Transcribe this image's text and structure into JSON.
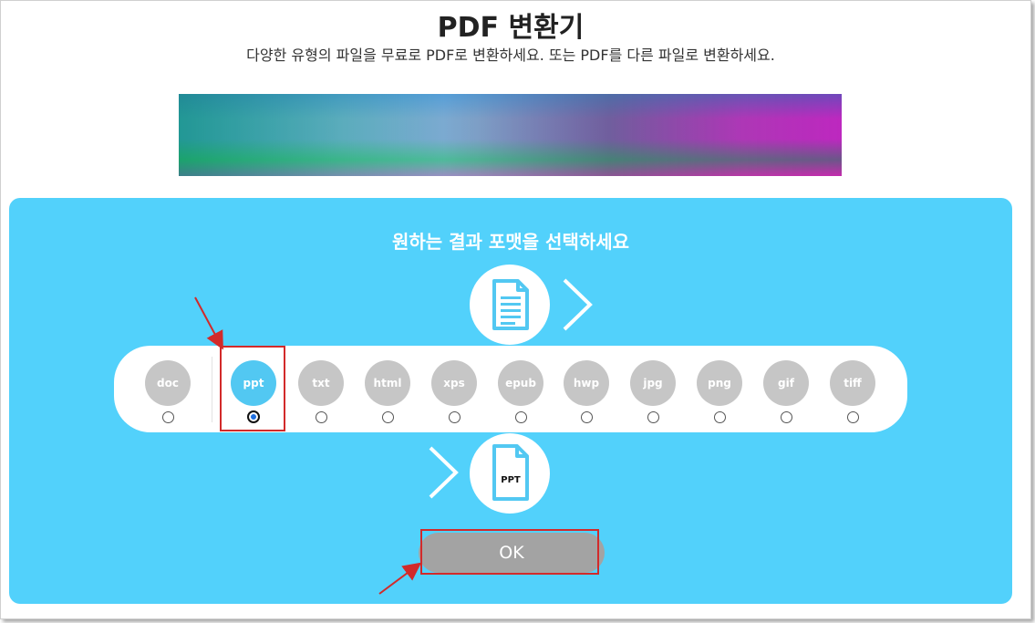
{
  "header": {
    "title": "PDF 변환기",
    "subtitle": "다양한 유형의 파일을 무료로 PDF로 변환하세요. 또는 PDF를 다른 파일로 변환하세요."
  },
  "converter": {
    "heading": "원하는 결과 포맷을 선택하세요",
    "source_icon": "document-icon",
    "target_icon": "ppt-file-icon",
    "target_label": "PPT",
    "formats": [
      {
        "label": "doc",
        "selected": false
      },
      {
        "label": "ppt",
        "selected": true
      },
      {
        "label": "txt",
        "selected": false
      },
      {
        "label": "html",
        "selected": false
      },
      {
        "label": "xps",
        "selected": false
      },
      {
        "label": "epub",
        "selected": false
      },
      {
        "label": "hwp",
        "selected": false
      },
      {
        "label": "jpg",
        "selected": false
      },
      {
        "label": "png",
        "selected": false
      },
      {
        "label": "gif",
        "selected": false
      },
      {
        "label": "tiff",
        "selected": false
      }
    ],
    "ok_label": "OK"
  },
  "colors": {
    "panel": "#52d1fb",
    "selected_format": "#52c8f2",
    "unselected_format": "#c6c6c6",
    "ok_button": "#a3a3a3",
    "annotation": "#d22a2a"
  }
}
